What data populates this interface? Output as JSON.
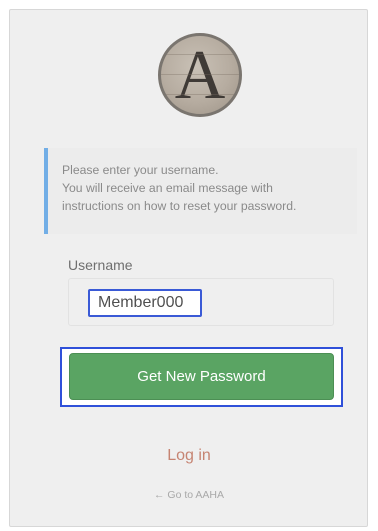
{
  "logo": {
    "letter": "A"
  },
  "notice": {
    "lines": [
      "Please enter your username.",
      "You will receive an email message with",
      "instructions on how to reset your password."
    ]
  },
  "form": {
    "username_label": "Username",
    "username_value": "Member000",
    "submit_label": "Get New Password"
  },
  "links": {
    "login": "Log in",
    "back": "← Go to AAHA"
  },
  "colors": {
    "notice_accent": "#72aee6",
    "button_green": "#5aa463",
    "focus_outline": "#2f50d9",
    "link": "#c68472"
  }
}
